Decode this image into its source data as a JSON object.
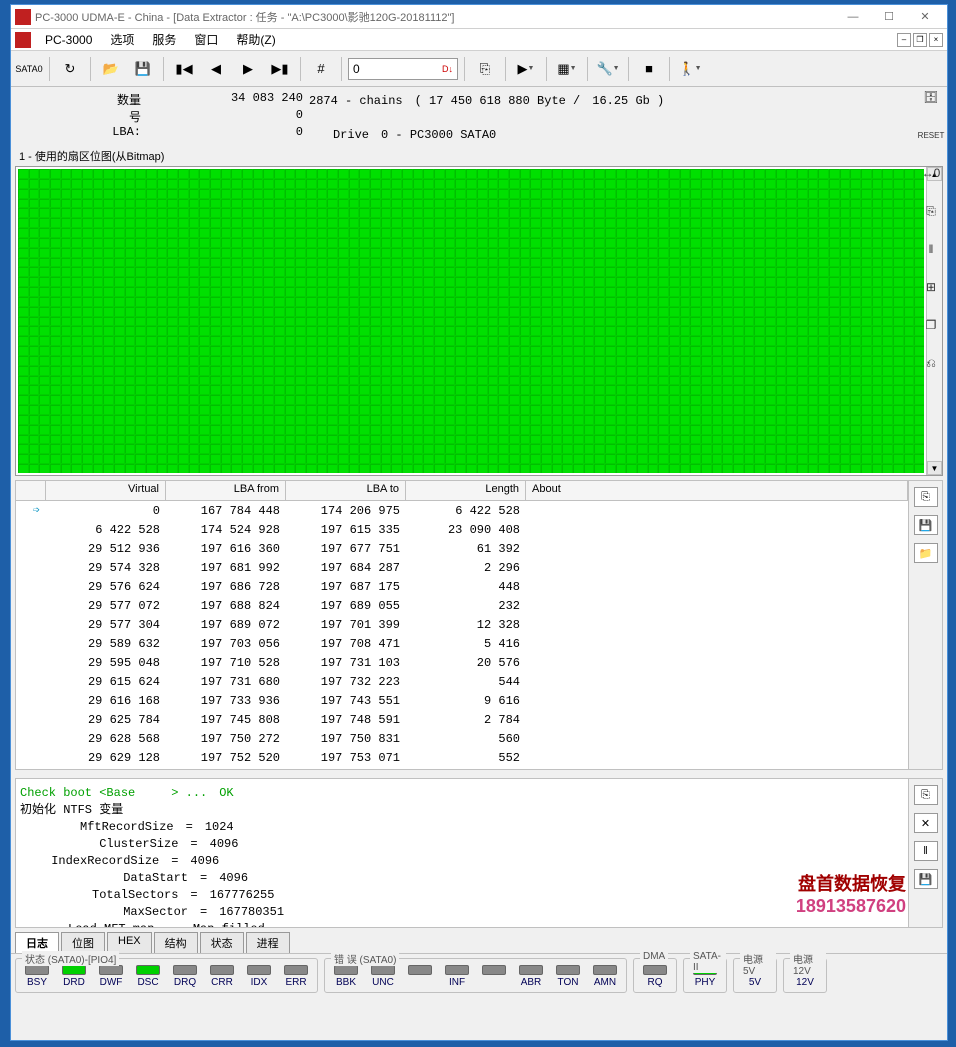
{
  "window": {
    "title": "PC-3000 UDMA-E - China - [Data Extractor : 任务 - \"A:\\PC3000\\影驰120G-20181112\"]"
  },
  "menu": {
    "app": "PC-3000",
    "items": [
      "选项",
      "服务",
      "窗口",
      "帮助(Z)"
    ]
  },
  "toolbar": {
    "sata_label": "SATA0",
    "input_value": "0",
    "input_badge": "D↓"
  },
  "info": {
    "count_label": "数量",
    "count_value": "34 083 240",
    "count_extra": "2874 - chains　( 17 450 618 880 Byte /　16.25 Gb )",
    "num_label": "号",
    "num_value": "0",
    "lba_label": "LBA:",
    "lba_value": "0",
    "drive_label": "Drive",
    "drive_value": "0 - PC3000 SATA0"
  },
  "bitmap": {
    "title": "1 - 使用的扇区位图(从Bitmap)"
  },
  "table": {
    "cols": [
      "Virtual",
      "LBA from",
      "LBA to",
      "Length",
      "About"
    ],
    "rows": [
      {
        "virtual": "0",
        "from": "167 784 448",
        "to": "174 206 975",
        "length": "6 422 528"
      },
      {
        "virtual": "6 422 528",
        "from": "174 524 928",
        "to": "197 615 335",
        "length": "23 090 408"
      },
      {
        "virtual": "29 512 936",
        "from": "197 616 360",
        "to": "197 677 751",
        "length": "61 392"
      },
      {
        "virtual": "29 574 328",
        "from": "197 681 992",
        "to": "197 684 287",
        "length": "2 296"
      },
      {
        "virtual": "29 576 624",
        "from": "197 686 728",
        "to": "197 687 175",
        "length": "448"
      },
      {
        "virtual": "29 577 072",
        "from": "197 688 824",
        "to": "197 689 055",
        "length": "232"
      },
      {
        "virtual": "29 577 304",
        "from": "197 689 072",
        "to": "197 701 399",
        "length": "12 328"
      },
      {
        "virtual": "29 589 632",
        "from": "197 703 056",
        "to": "197 708 471",
        "length": "5 416"
      },
      {
        "virtual": "29 595 048",
        "from": "197 710 528",
        "to": "197 731 103",
        "length": "20 576"
      },
      {
        "virtual": "29 615 624",
        "from": "197 731 680",
        "to": "197 732 223",
        "length": "544"
      },
      {
        "virtual": "29 616 168",
        "from": "197 733 936",
        "to": "197 743 551",
        "length": "9 616"
      },
      {
        "virtual": "29 625 784",
        "from": "197 745 808",
        "to": "197 748 591",
        "length": "2 784"
      },
      {
        "virtual": "29 628 568",
        "from": "197 750 272",
        "to": "197 750 831",
        "length": "560"
      },
      {
        "virtual": "29 629 128",
        "from": "197 752 520",
        "to": "197 753 071",
        "length": "552"
      }
    ]
  },
  "log": {
    "line1": "Check boot <Base　　　> ...　OK",
    "line2": "初始化 NTFS 变量",
    "line3": "　　　　　MftRecordSize　=　1024",
    "line4": "　　　　　　 ClusterSize　=　4096",
    "line5": "　　 IndexRecordSize　=　4096",
    "line6": "　　　　　　　　 DataStart　=　4096",
    "line7": "　　　　　　TotalSectors　=　167776255",
    "line8": "　　　　　　　　 MaxSector　=　167780351",
    "line9": "　　　　Load MFT map　　- Map filled"
  },
  "tabs": [
    "日志",
    "位图",
    "HEX",
    "结构",
    "状态",
    "进程"
  ],
  "status": {
    "g1_title": "状态 (SATA0)-[PIO4]",
    "g1_leds": [
      {
        "label": "BSY",
        "on": false
      },
      {
        "label": "DRD",
        "on": true
      },
      {
        "label": "DWF",
        "on": false
      },
      {
        "label": "DSC",
        "on": true
      },
      {
        "label": "DRQ",
        "on": false
      },
      {
        "label": "CRR",
        "on": false
      },
      {
        "label": "IDX",
        "on": false
      },
      {
        "label": "ERR",
        "on": false
      }
    ],
    "g2_title": "错 误 (SATA0)",
    "g2_leds": [
      {
        "label": "BBK",
        "on": false
      },
      {
        "label": "UNC",
        "on": false
      },
      {
        "label": "",
        "on": false
      },
      {
        "label": "INF",
        "on": false
      },
      {
        "label": "",
        "on": false
      },
      {
        "label": "ABR",
        "on": false
      },
      {
        "label": "TON",
        "on": false
      },
      {
        "label": "AMN",
        "on": false
      }
    ],
    "g3_title": "DMA",
    "g3_leds": [
      {
        "label": "RQ",
        "on": false
      }
    ],
    "g4_title": "SATA-II",
    "g4_leds": [
      {
        "label": "PHY",
        "on": true
      }
    ],
    "g5_title": "电源 5V",
    "g5_leds": [
      {
        "label": "5V",
        "on": true
      }
    ],
    "g6_title": "电源 12V",
    "g6_leds": [
      {
        "label": "12V",
        "on": true
      }
    ]
  },
  "watermark": {
    "line1": "盘首数据恢复",
    "line2": "18913587620"
  },
  "right_tools": [
    "DB",
    "RESET",
    "↔0",
    "⎘",
    "‖",
    "⊞",
    "⊡",
    "⎌"
  ]
}
